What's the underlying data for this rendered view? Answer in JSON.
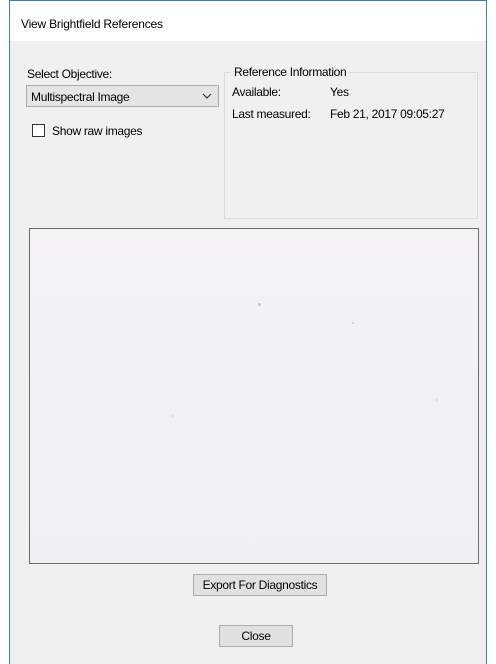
{
  "window": {
    "title": "View Brightfield References"
  },
  "objective": {
    "label": "Select Objective:",
    "selected": "Multispectral Image",
    "show_raw_label": "Show raw images",
    "show_raw_checked": false
  },
  "reference_info": {
    "legend": "Reference Information",
    "available_label": "Available:",
    "available_value": "Yes",
    "last_measured_label": "Last measured:",
    "last_measured_value": "Feb 21, 2017 09:05:27"
  },
  "buttons": {
    "export_label": "Export For Diagnostics",
    "close_label": "Close"
  }
}
